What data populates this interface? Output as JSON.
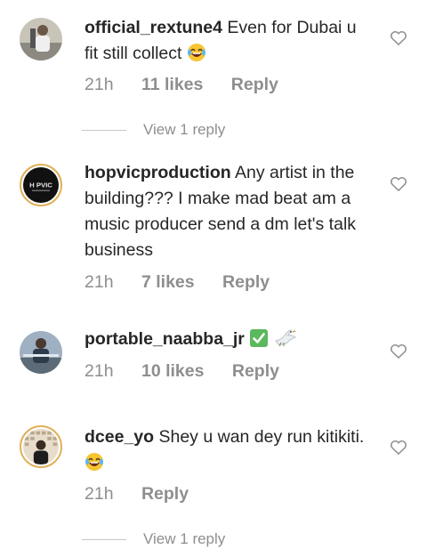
{
  "comments": [
    {
      "username": "official_rextune4",
      "text": "Even for Dubai u fit still collect",
      "emoji": "laughing-tears-emoji",
      "time": "21h",
      "likes": "11 likes",
      "reply": "Reply",
      "avatar": "official-rextune4-avatar"
    },
    {
      "username": "hopvicproduction",
      "text": "Any artist in the building??? I make mad beat am a music producer send a dm let's talk business",
      "time": "21h",
      "likes": "7 likes",
      "reply": "Reply",
      "avatar": "hopvicproduction-avatar",
      "avatar_logo_text": "H PVIC"
    },
    {
      "username": "portable_naabba_jr",
      "text": "",
      "emoji": "check-mark-emoji dove-emoji",
      "time": "21h",
      "likes": "10 likes",
      "reply": "Reply",
      "avatar": "portable-naabba-jr-avatar"
    },
    {
      "username": "dcee_yo",
      "text": "Shey u wan dey run kitikiti.",
      "emoji": "laughing-tears-emoji",
      "time": "21h",
      "reply": "Reply",
      "avatar": "dcee-yo-avatar"
    }
  ],
  "view_replies_1": "View 1 reply",
  "view_replies_2": "View 1 reply",
  "colors": {
    "text": "#262626",
    "secondary": "#8e8e8e",
    "story_ring": "#e0b15a",
    "check_green": "#5cb85c"
  }
}
